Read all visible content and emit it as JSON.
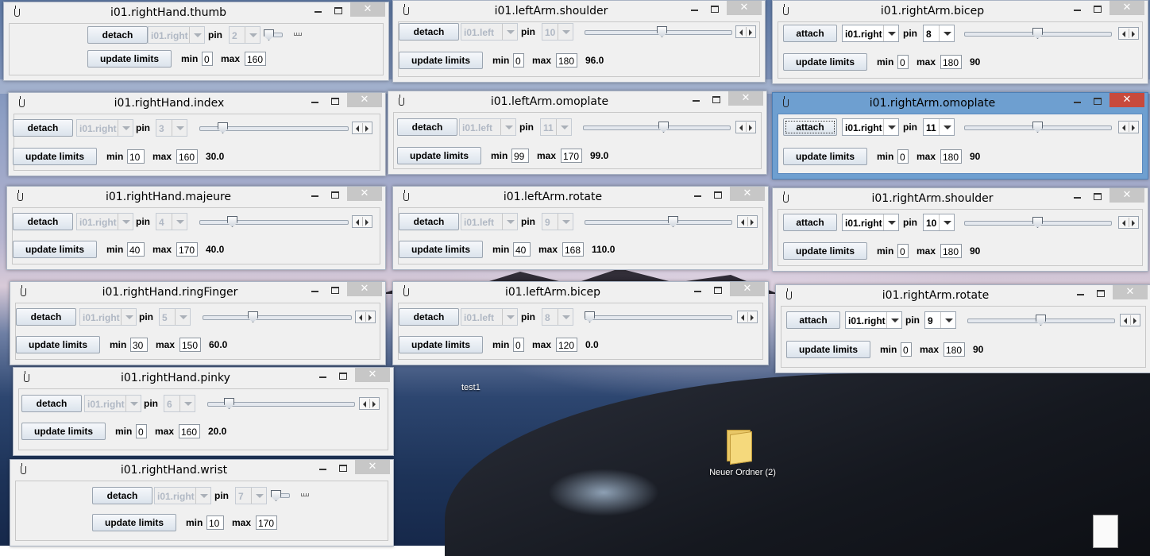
{
  "desktop": {
    "folder_label": "Neuer Ordner (2)",
    "test_label": "test1"
  },
  "labels": {
    "pin": "pin",
    "min": "min",
    "max": "max",
    "update": "update limits"
  },
  "windows": {
    "rh_thumb": {
      "title": "i01.rightHand.thumb",
      "action": "detach",
      "controller": "i01.right",
      "pin": "2",
      "min": "0",
      "max": "160",
      "value": "",
      "position": 0
    },
    "rh_index": {
      "title": "i01.rightHand.index",
      "action": "detach",
      "controller": "i01.right",
      "pin": "3",
      "min": "10",
      "max": "160",
      "value": "30.0",
      "position": 0.13
    },
    "rh_majeure": {
      "title": "i01.rightHand.majeure",
      "action": "detach",
      "controller": "i01.right",
      "pin": "4",
      "min": "40",
      "max": "170",
      "value": "40.0",
      "position": 0.2
    },
    "rh_ring": {
      "title": "i01.rightHand.ringFinger",
      "action": "detach",
      "controller": "i01.right",
      "pin": "5",
      "min": "30",
      "max": "150",
      "value": "60.0",
      "position": 0.33
    },
    "rh_pinky": {
      "title": "i01.rightHand.pinky",
      "action": "detach",
      "controller": "i01.right",
      "pin": "6",
      "min": "0",
      "max": "160",
      "value": "20.0",
      "position": 0.12
    },
    "rh_wrist": {
      "title": "i01.rightHand.wrist",
      "action": "detach",
      "controller": "i01.right",
      "pin": "7",
      "min": "10",
      "max": "170",
      "value": "",
      "position": 0
    },
    "la_shoulder": {
      "title": "i01.leftArm.shoulder",
      "action": "detach",
      "controller": "i01.left",
      "pin": "10",
      "min": "0",
      "max": "180",
      "value": "96.0",
      "position": 0.53
    },
    "la_omoplate": {
      "title": "i01.leftArm.omoplate",
      "action": "detach",
      "controller": "i01.left",
      "pin": "11",
      "min": "99",
      "max": "170",
      "value": "99.0",
      "position": 0.55
    },
    "la_rotate": {
      "title": "i01.leftArm.rotate",
      "action": "detach",
      "controller": "i01.left",
      "pin": "9",
      "min": "40",
      "max": "168",
      "value": "110.0",
      "position": 0.61
    },
    "la_bicep": {
      "title": "i01.leftArm.bicep",
      "action": "detach",
      "controller": "i01.left",
      "pin": "8",
      "min": "0",
      "max": "120",
      "value": "0.0",
      "position": 0
    },
    "ra_bicep": {
      "title": "i01.rightArm.bicep",
      "action": "attach",
      "controller": "i01.right",
      "pin": "8",
      "min": "0",
      "max": "180",
      "value": "90",
      "position": 0.5
    },
    "ra_omoplate": {
      "title": "i01.rightArm.omoplate",
      "action": "attach",
      "controller": "i01.right",
      "pin": "11",
      "min": "0",
      "max": "180",
      "value": "90",
      "position": 0.5
    },
    "ra_shoulder": {
      "title": "i01.rightArm.shoulder",
      "action": "attach",
      "controller": "i01.right",
      "pin": "10",
      "min": "0",
      "max": "180",
      "value": "90",
      "position": 0.5
    },
    "ra_rotate": {
      "title": "i01.rightArm.rotate",
      "action": "attach",
      "controller": "i01.right",
      "pin": "9",
      "min": "0",
      "max": "180",
      "value": "90",
      "position": 0.5
    }
  },
  "colors": {
    "active_titlebar": "#6e9fd0",
    "close_active": "#c84a3c",
    "disabled_text": "#b0b8c4"
  }
}
